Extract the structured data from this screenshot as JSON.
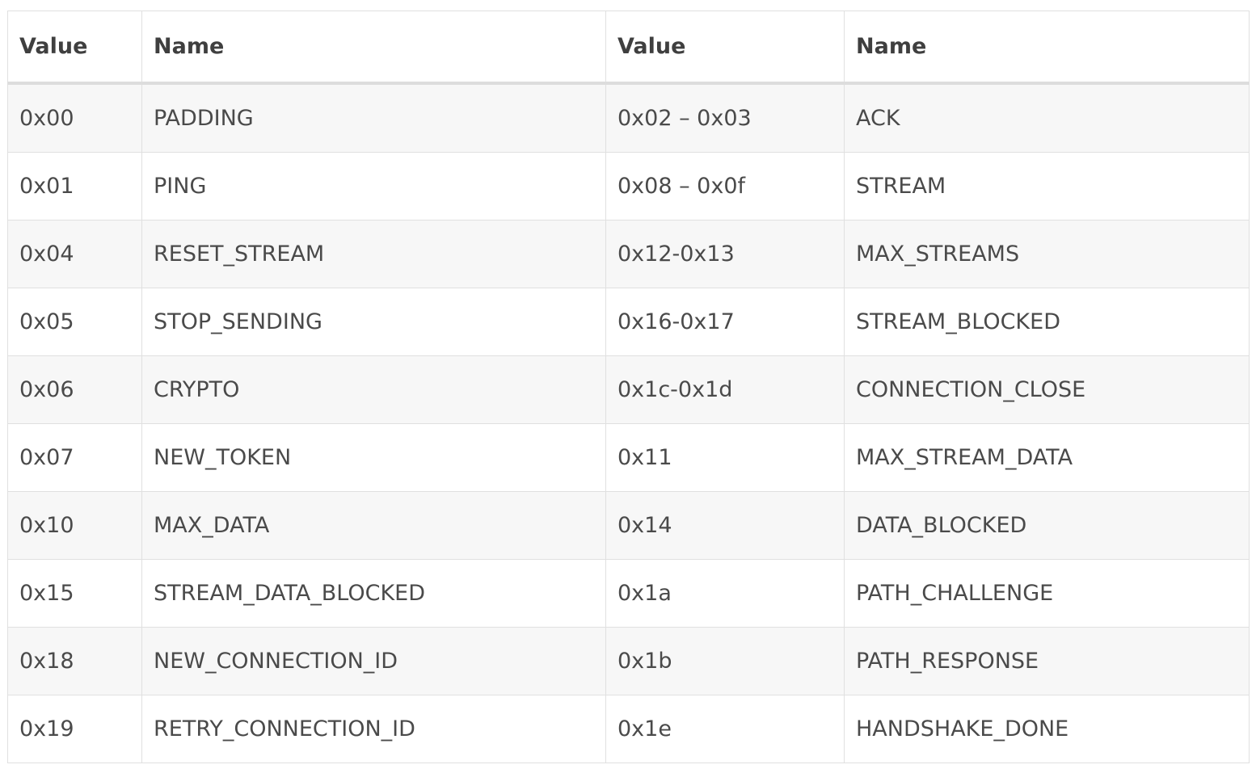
{
  "table": {
    "headers": [
      "Value",
      "Name",
      "Value",
      "Name"
    ],
    "rows": [
      [
        "0x00",
        "PADDING",
        "0x02 – 0x03",
        "ACK"
      ],
      [
        "0x01",
        "PING",
        "0x08 – 0x0f",
        "STREAM"
      ],
      [
        "0x04",
        "RESET_STREAM",
        "0x12-0x13",
        "MAX_STREAMS"
      ],
      [
        "0x05",
        "STOP_SENDING",
        "0x16-0x17",
        "STREAM_BLOCKED"
      ],
      [
        "0x06",
        "CRYPTO",
        "0x1c-0x1d",
        "CONNECTION_CLOSE"
      ],
      [
        "0x07",
        "NEW_TOKEN",
        "0x11",
        "MAX_STREAM_DATA"
      ],
      [
        "0x10",
        "MAX_DATA",
        "0x14",
        "DATA_BLOCKED"
      ],
      [
        "0x15",
        "STREAM_DATA_BLOCKED",
        "0x1a",
        "PATH_CHALLENGE"
      ],
      [
        "0x18",
        "NEW_CONNECTION_ID",
        "0x1b",
        "PATH_RESPONSE"
      ],
      [
        "0x19",
        "RETRY_CONNECTION_ID",
        "0x1e",
        "HANDSHAKE_DONE"
      ]
    ]
  }
}
